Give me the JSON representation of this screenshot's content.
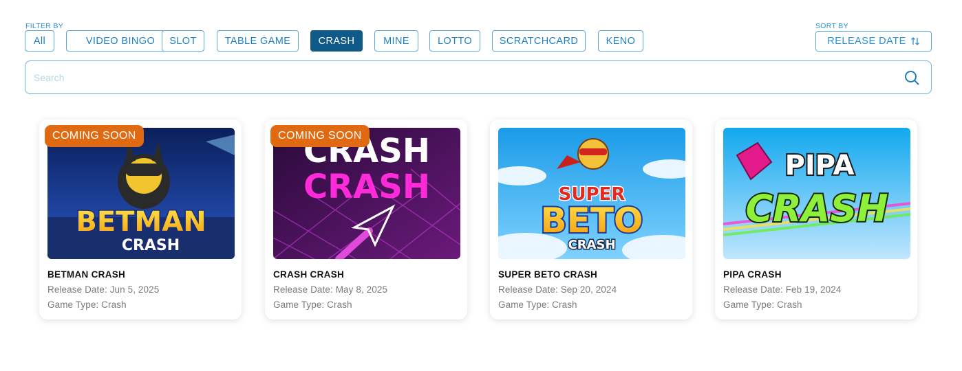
{
  "filter": {
    "label": "FILTER BY",
    "chips": [
      {
        "label": "All",
        "active": false
      },
      {
        "label": "VIDEO BINGO",
        "active": false
      },
      {
        "label": "SLOT",
        "active": false
      },
      {
        "label": "TABLE GAME",
        "active": false
      },
      {
        "label": "CRASH",
        "active": true
      },
      {
        "label": "MINE",
        "active": false
      },
      {
        "label": "LOTTO",
        "active": false
      },
      {
        "label": "SCRATCHCARD",
        "active": false
      },
      {
        "label": "KENO",
        "active": false
      }
    ]
  },
  "sort": {
    "label": "SORT BY",
    "value": "RELEASE DATE"
  },
  "search": {
    "placeholder": "Search"
  },
  "games": [
    {
      "title": "BETMAN CRASH",
      "badge": "COMING SOON",
      "release": "Release Date: Jun 5, 2025",
      "type": "Game Type: Crash",
      "art_text": [
        "BETMAN",
        "CRASH"
      ]
    },
    {
      "title": "CRASH CRASH",
      "badge": "COMING SOON",
      "release": "Release Date: May 8, 2025",
      "type": "Game Type: Crash",
      "art_text": [
        "CRASH",
        "CRASH"
      ]
    },
    {
      "title": "SUPER BETO CRASH",
      "badge": "",
      "release": "Release Date: Sep 20, 2024",
      "type": "Game Type: Crash",
      "art_text": [
        "SUPER",
        "BETO",
        "CRASH"
      ]
    },
    {
      "title": "PIPA CRASH",
      "badge": "",
      "release": "Release Date: Feb 19, 2024",
      "type": "Game Type: Crash",
      "art_text": [
        "PIPA",
        "CRASH"
      ]
    }
  ],
  "colors": {
    "accent": "#1f7fc0",
    "active_chip": "#0f5a86",
    "badge": "#e06a12"
  }
}
